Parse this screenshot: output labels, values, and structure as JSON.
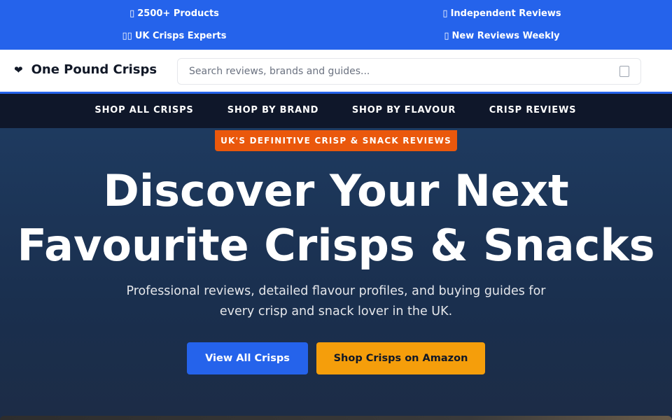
{
  "topbar": {
    "items": [
      {
        "icon": "box-icon",
        "glyph": "▯",
        "label": "2500+ Products"
      },
      {
        "icon": "checkmark-icon",
        "glyph": "▯",
        "label": "Independent Reviews"
      },
      {
        "icon": "uk-flag-icon",
        "glyph": "▯▯",
        "label": "UK Crisps Experts"
      },
      {
        "icon": "newspaper-icon",
        "glyph": "▯",
        "label": "New Reviews Weekly"
      }
    ],
    "bg_color": "#2563eb"
  },
  "header": {
    "logo_icon": "heart-icon",
    "logo_glyph": "❤",
    "site_name": "One Pound Crisps",
    "search_placeholder": "Search reviews, brands and guides...",
    "search_icon": "search-icon"
  },
  "nav": {
    "links": [
      "SHOP ALL CRISPS",
      "SHOP BY BRAND",
      "SHOP BY FLAVOUR",
      "CRISP REVIEWS"
    ],
    "bg_color": "#0f172a"
  },
  "hero": {
    "badge": "UK'S DEFINITIVE CRISP & SNACK REVIEWS",
    "badge_color": "#ea580c",
    "title_line1": "Discover Your Next",
    "title_line2": "Favourite Crisps & Snacks",
    "subtitle_line1": "Professional reviews, detailed flavour profiles, and buying guides for",
    "subtitle_line2": "every crisp and snack lover in the UK.",
    "primary_button": "View All Crisps",
    "amazon_button": "Shop Crisps on Amazon",
    "primary_color": "#2563eb",
    "amazon_color": "#f59e0b"
  }
}
